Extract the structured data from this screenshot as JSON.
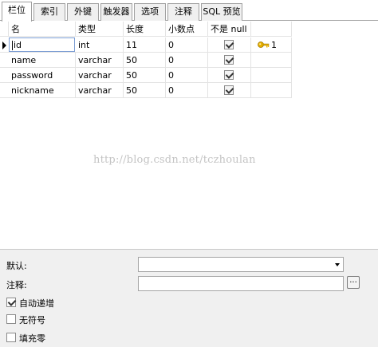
{
  "tabs": [
    {
      "label": "栏位",
      "active": true
    },
    {
      "label": "索引",
      "active": false
    },
    {
      "label": "外键",
      "active": false
    },
    {
      "label": "触发器",
      "active": false
    },
    {
      "label": "选项",
      "active": false
    },
    {
      "label": "注释",
      "active": false
    },
    {
      "label": "SQL 预览",
      "active": false
    }
  ],
  "grid": {
    "headers": [
      "名",
      "类型",
      "长度",
      "小数点",
      "不是 null",
      ""
    ],
    "rows": [
      {
        "name": "id",
        "type": "int",
        "length": "11",
        "decimals": "0",
        "not_null": true,
        "key": "1"
      },
      {
        "name": "name",
        "type": "varchar",
        "length": "50",
        "decimals": "0",
        "not_null": true,
        "key": ""
      },
      {
        "name": "password",
        "type": "varchar",
        "length": "50",
        "decimals": "0",
        "not_null": true,
        "key": ""
      },
      {
        "name": "nickname",
        "type": "varchar",
        "length": "50",
        "decimals": "0",
        "not_null": true,
        "key": ""
      }
    ]
  },
  "watermark": "http://blog.csdn.net/tczhoulan",
  "panel": {
    "default_label": "默认:",
    "default_value": "",
    "comment_label": "注释:",
    "comment_value": "",
    "ellipsis_label": "...",
    "auto_increment_label": "自动递增",
    "auto_increment_checked": true,
    "unsigned_label": "无符号",
    "unsigned_checked": false,
    "zerofill_label": "填充零",
    "zerofill_checked": false
  },
  "colors": {
    "key_icon": "#e8b000",
    "grid_line": "#e3e3e3",
    "panel_bg": "#f0f0f0"
  }
}
